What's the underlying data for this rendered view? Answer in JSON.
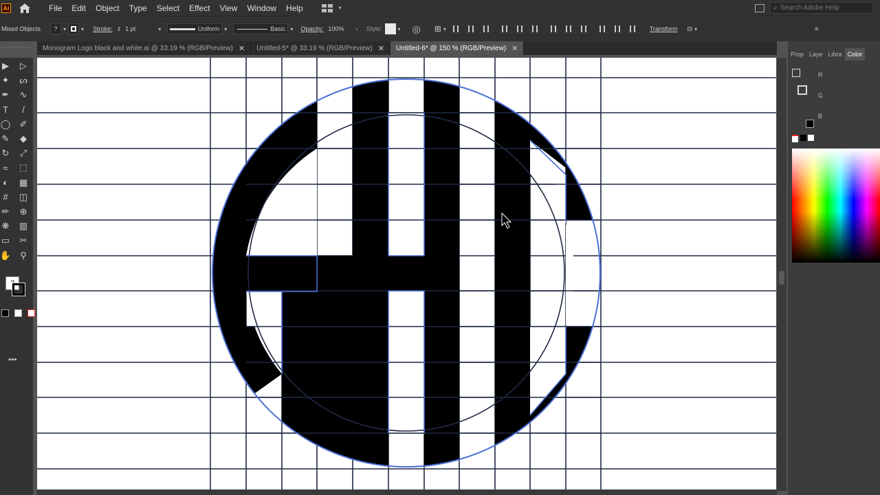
{
  "app": {
    "logo_text": "Ai"
  },
  "menu": [
    "File",
    "Edit",
    "Object",
    "Type",
    "Select",
    "Effect",
    "View",
    "Window",
    "Help"
  ],
  "search": {
    "placeholder": "Search Adobe Help"
  },
  "control_bar": {
    "selection": "Mixed Objects",
    "stroke_label": "Stroke:",
    "stroke_weight": "1 pt",
    "profile": "Uniform",
    "brush": "Basic",
    "opacity_label": "Opacity:",
    "opacity_value": "100%",
    "style_label": "Style:",
    "transform_label": "Transform"
  },
  "tabs": [
    {
      "label": "Monogram Logo black and white.ai @ 33.19 % (RGB/Preview)",
      "active": false
    },
    {
      "label": "Untitled-5* @ 33.19 % (RGB/Preview)",
      "active": false
    },
    {
      "label": "Untitled-6* @ 150 % (RGB/Preview)",
      "active": true
    }
  ],
  "right_panel": {
    "tabs": [
      "Prop",
      "Laye",
      "Libra",
      "Color"
    ],
    "channels": [
      "R",
      "G",
      "B"
    ]
  },
  "colors": {
    "ui_dark": "#323232",
    "canvas": "#ffffff",
    "grid_lines": "#1f2a44",
    "selection_blue": "#4a6fd6",
    "glyph_fill": "#000000"
  },
  "tool_icons": [
    "selection-tool-icon",
    "direct-selection-tool-icon",
    "magic-wand-icon",
    "lasso-icon",
    "pen-icon",
    "curvature-icon",
    "type-icon",
    "line-icon",
    "ellipse-icon",
    "paintbrush-icon",
    "shaper-icon",
    "eraser-icon",
    "rotate-icon",
    "scale-icon",
    "width-icon",
    "free-transform-icon",
    "shape-builder-icon",
    "perspective-icon",
    "mesh-icon",
    "gradient-icon",
    "eyedropper-icon",
    "blend-icon",
    "symbol-sprayer-icon",
    "graph-icon",
    "artboard-icon",
    "slice-icon",
    "hand-icon",
    "zoom-icon"
  ]
}
